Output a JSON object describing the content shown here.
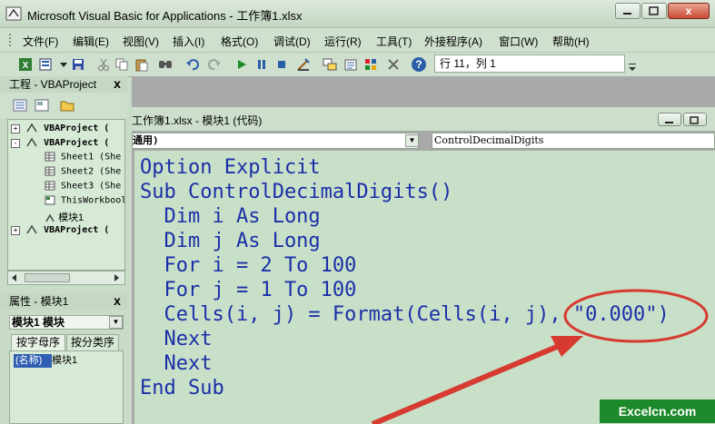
{
  "window": {
    "title": "Microsoft Visual Basic for Applications - 工作簿1.xlsx",
    "close_glyph": "x"
  },
  "menu": [
    "文件(F)",
    "编辑(E)",
    "视图(V)",
    "插入(I)",
    "格式(O)",
    "调试(D)",
    "运行(R)",
    "工具(T)",
    "外接程序(A)",
    "窗口(W)",
    "帮助(H)"
  ],
  "toolbar": {
    "position": "行 11，列 1",
    "icons": [
      "excel-icon",
      "insert-module-icon",
      "save-icon",
      "cut-icon",
      "copy-icon",
      "paste-icon",
      "find-icon",
      "undo-icon",
      "redo-icon",
      "run-icon",
      "break-icon",
      "reset-icon",
      "design-mode-icon",
      "project-explorer-icon",
      "properties-icon",
      "object-browser-icon",
      "toolbox-icon",
      "help-icon"
    ]
  },
  "project": {
    "title": "工程 - VBAProject",
    "close_glyph": "x",
    "tree": [
      {
        "label": "VBAProject (",
        "level": 0,
        "expander": "+",
        "bold": true
      },
      {
        "label": "VBAProject (",
        "level": 0,
        "expander": "-",
        "bold": true
      },
      {
        "label": "Sheet1 (She",
        "level": 2
      },
      {
        "label": "Sheet2 (She",
        "level": 2
      },
      {
        "label": "Sheet3 (She",
        "level": 2
      },
      {
        "label": "ThisWorkbool",
        "level": 2
      },
      {
        "label": "模块1",
        "level": 2
      },
      {
        "label": "VBAProject (",
        "level": 0,
        "expander": "+",
        "bold": true
      }
    ]
  },
  "properties": {
    "title": "属性 - 模块1",
    "close_glyph": "x",
    "object": "模块1 模块",
    "tabs": [
      "按字母序",
      "按分类序"
    ],
    "rows": [
      {
        "name": "(名称)",
        "value": "模块1"
      }
    ]
  },
  "code_window": {
    "title": "工作簿1.xlsx - 模块1 (代码)",
    "object_combo": "通用)",
    "proc_combo": "ControlDecimalDigits",
    "lines": [
      "Option Explicit",
      "Sub ControlDecimalDigits()",
      "  Dim i As Long",
      "  Dim j As Long",
      "  For i = 2 To 100",
      "  For j = 1 To 100",
      "  Cells(i, j) = Format(Cells(i, j), \"0.000\")",
      "  Next",
      "  Next",
      "End Sub"
    ]
  },
  "watermark": "Excelcn.com",
  "colors": {
    "code_bg": "#c9e0c8",
    "code_text": "#1a2fa8",
    "annotation": "#d63a30",
    "watermark_bg": "#1c8a2a"
  }
}
